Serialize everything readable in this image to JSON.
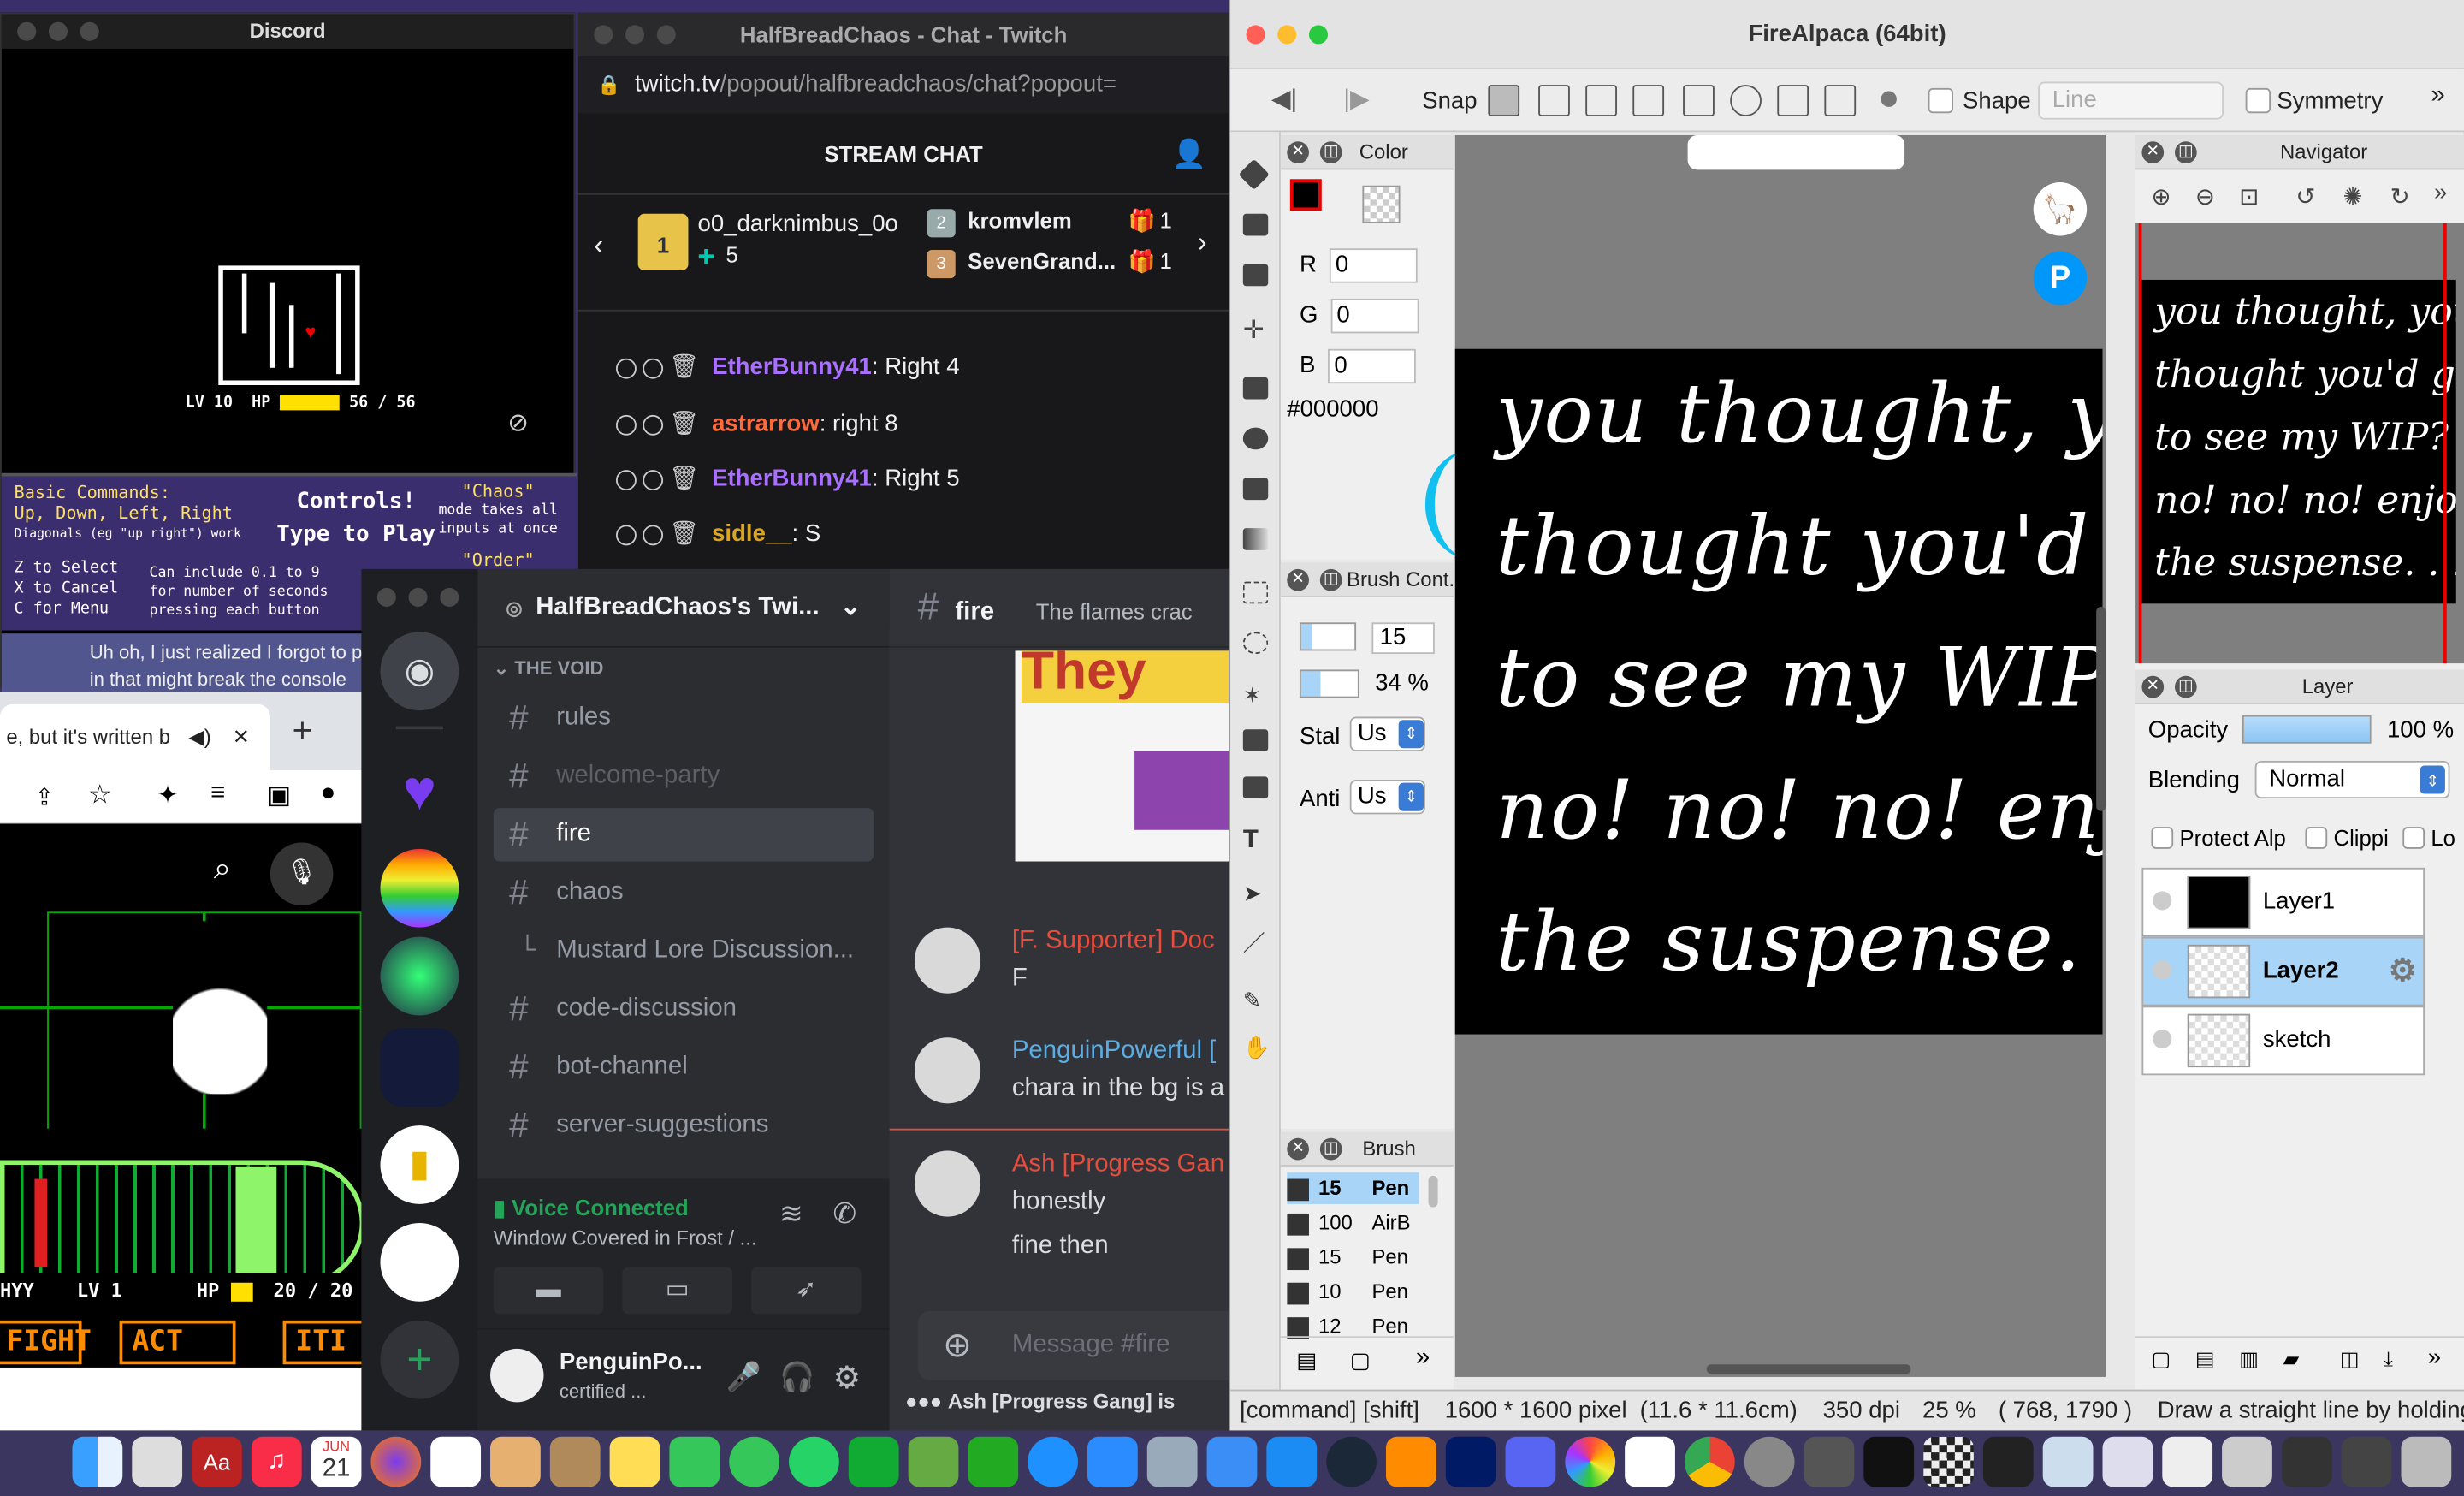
{
  "game_window": {
    "title": "Discord",
    "lv": "LV 10",
    "hp_label": "HP",
    "hp": "56 / 56"
  },
  "commands": {
    "basic_title": "Basic Commands:",
    "basic_line": "Up, Down, Left, Right",
    "diag": "Diagonals (eg \"up right\") work",
    "z": "Z to Select",
    "x": "X to Cancel",
    "c": "C for Menu",
    "controls_title": "Controls!",
    "controls_sub": "Type to Play",
    "chaos_title": "\"Chaos\"",
    "chaos_1": "mode takes all",
    "chaos_2": "inputs at once",
    "order": "\"Order\"",
    "include_1": "Can include 0.1 to 9",
    "include_2": "for number of seconds",
    "include_3": "pressing each button"
  },
  "ohno": {
    "line1": "Uh oh, I just realized I forgot to p",
    "line2": "in that might break the console"
  },
  "browser": {
    "tab_title": "e, but it's written b",
    "new_tab": "+"
  },
  "battle": {
    "name": "HYY",
    "lv": "LV 1",
    "hp_label": "HP",
    "hp": "20 / 20",
    "fight": "FIGHT",
    "act": "ACT",
    "item": "ITI"
  },
  "twitch": {
    "title": "HalfBreadChaos - Chat - Twitch",
    "url_host": "twitch.tv",
    "url_path": "/popout/halfbreadchaos/chat?popout=",
    "header": "STREAM CHAT",
    "gifters": [
      {
        "rank": "1",
        "name": "o0_darknimbus_0o",
        "count": "5"
      },
      {
        "rank": "2",
        "name": "kromvlem",
        "count": "1"
      },
      {
        "rank": "3",
        "name": "SevenGrand...",
        "count": "1"
      }
    ],
    "messages": [
      {
        "user": "EtherBunny41",
        "text": ": Right 4",
        "color": "#a970ff"
      },
      {
        "user": "astrarrow",
        "text": ": right 8",
        "color": "#ff6a3d"
      },
      {
        "user": "EtherBunny41",
        "text": ": Right 5",
        "color": "#a970ff"
      },
      {
        "user": "sidle__",
        "text": ": S",
        "color": "#daa520"
      }
    ]
  },
  "discord": {
    "server": "HalfBreadChaos's Twi...",
    "category": "THE VOID",
    "channels": [
      {
        "name": "rules"
      },
      {
        "name": "welcome-party"
      },
      {
        "name": "fire"
      },
      {
        "name": "chaos"
      },
      {
        "name": "Mustard Lore Discussion..."
      },
      {
        "name": "code-discussion"
      },
      {
        "name": "bot-channel"
      },
      {
        "name": "server-suggestions"
      }
    ],
    "channel_header": "fire",
    "channel_topic": "The flames crac",
    "voice": {
      "status": "Voice Connected",
      "detail": "Window Covered in Frost / ..."
    },
    "user": {
      "name": "PenguinPo...",
      "status": "certified ..."
    },
    "messages": [
      {
        "name": "[F. Supporter] Doc",
        "text": "F",
        "color": "#e74c3c"
      },
      {
        "name": "PenguinPowerful [",
        "text": "chara in the bg is a",
        "color": "#5dade2"
      },
      {
        "name": "Ash [Progress Gan",
        "text": "honestly",
        "text2": "fine then",
        "color": "#e74c3c"
      }
    ],
    "image_text": "They",
    "message_placeholder": "Message #fire",
    "typing": "Ash [Progress Gang] is"
  },
  "firealpaca": {
    "title": "FireAlpaca (64bit)",
    "snap": "Snap",
    "shape": "Shape",
    "shape_select": "Line",
    "symmetry": "Symmetry",
    "color_panel": "Color",
    "r": "R",
    "g": "G",
    "b": "B",
    "r_val": "0",
    "g_val": "0",
    "b_val": "0",
    "hex": "#000000",
    "brush_control": "Brush Cont...",
    "size": "15",
    "opacity": "34 %",
    "stab": "Stal",
    "stab_val": "Us",
    "anti": "Anti",
    "anti_val": "Us",
    "brush_panel": "Brush",
    "brushes": [
      {
        "size": "15",
        "name": "Pen"
      },
      {
        "size": "100",
        "name": "AirB"
      },
      {
        "size": "15",
        "name": "Pen"
      },
      {
        "size": "10",
        "name": "Pen"
      },
      {
        "size": "12",
        "name": "Pen"
      }
    ],
    "navigator": "Navigator",
    "layer_panel": "Layer",
    "opacity_label": "Opacity",
    "opacity_val": "100 %",
    "blending_label": "Blending",
    "blending_val": "Normal",
    "protect": "Protect Alp",
    "clipping": "Clippi",
    "lock": "Lo",
    "layers": [
      "Layer1",
      "Layer2",
      "sketch"
    ],
    "canvas_lines": [
      "you thought, you",
      "thought you'd get",
      "to see my WIP?",
      "no! no! no! enjoy",
      "the suspense. . ."
    ],
    "status": {
      "keys": "[command] [shift]",
      "size": "1600 * 1600 pixel",
      "cm": "(11.6 * 11.6cm)",
      "dpi": "350 dpi",
      "zoom": "25 %",
      "coords": "( 768, 1790 )",
      "hint": "Draw a straight line by holding c"
    }
  },
  "dock": {
    "calendar_month": "JUN",
    "calendar_day": "21"
  },
  "colors": {
    "twitch_bg": "#18181b",
    "discord_bg": "#313338",
    "selected_layer": "#a8d4f7"
  }
}
